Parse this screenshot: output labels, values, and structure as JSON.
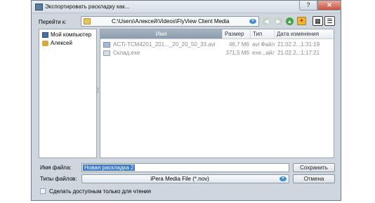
{
  "window": {
    "title": "Экспортировать раскладку как...",
    "help_glyph": "?",
    "close_glyph": "✕"
  },
  "toolbar": {
    "goto_label": "Перейти к:",
    "path": "C:\\Users\\Алексей\\Videos\\FlyView Client Media",
    "dropdown_glyph": "▾",
    "back_glyph": "◀",
    "forward_glyph": "▶",
    "up_glyph": "▲",
    "new_folder_glyph": "✦",
    "view_icons_glyph": "▦",
    "view_details_glyph": "☰"
  },
  "tree": {
    "items": [
      {
        "label": "Мой компьютер",
        "icon": "computer-icon"
      },
      {
        "label": "Алексей",
        "icon": "user-folder-icon"
      }
    ]
  },
  "files": {
    "columns": [
      "Имя",
      "Размер",
      "Тип",
      "Дата изменения"
    ],
    "rows": [
      {
        "name": "ACTi-TCM4201_201..._20_20_50_33.avi",
        "size": "46,7 Мб",
        "type": "avi Файл",
        "date": "21.02.2...1:31:19",
        "icon": "video-file-icon"
      },
      {
        "name": "Склад.exe",
        "size": "371,5 Мб",
        "type": "exe...айл",
        "date": "21.02.2...1:17:21",
        "icon": "exe-file-icon"
      }
    ]
  },
  "form": {
    "filename_label": "Имя файла:",
    "filename_value": "Новая раскладка 2",
    "filetype_label": "Типы файлов:",
    "filetype_value": "iPera Media File (*.nov)",
    "save_button": "Сохранить",
    "cancel_button": "Отмена",
    "readonly_label": "Сделать доступным только для чтения",
    "readonly_checked": false
  }
}
